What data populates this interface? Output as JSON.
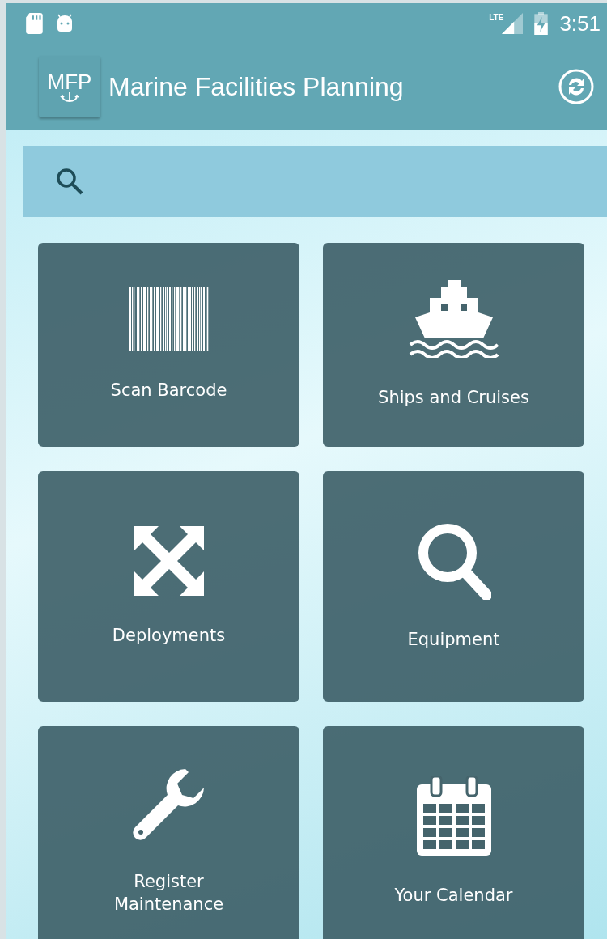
{
  "status_bar": {
    "network_label": "LTE",
    "time": "3:51"
  },
  "app_bar": {
    "logo_text": "MFP",
    "title": "Marine Facilities Planning"
  },
  "tiles": [
    {
      "kind": "barcode",
      "label": "Scan Barcode"
    },
    {
      "kind": "ship",
      "label": "Ships and Cruises"
    },
    {
      "kind": "expand",
      "label": "Deployments"
    },
    {
      "kind": "search",
      "label": "Equipment"
    },
    {
      "kind": "wrench",
      "label": "Register Maintenance"
    },
    {
      "kind": "calendar",
      "label": "Your Calendar"
    }
  ]
}
